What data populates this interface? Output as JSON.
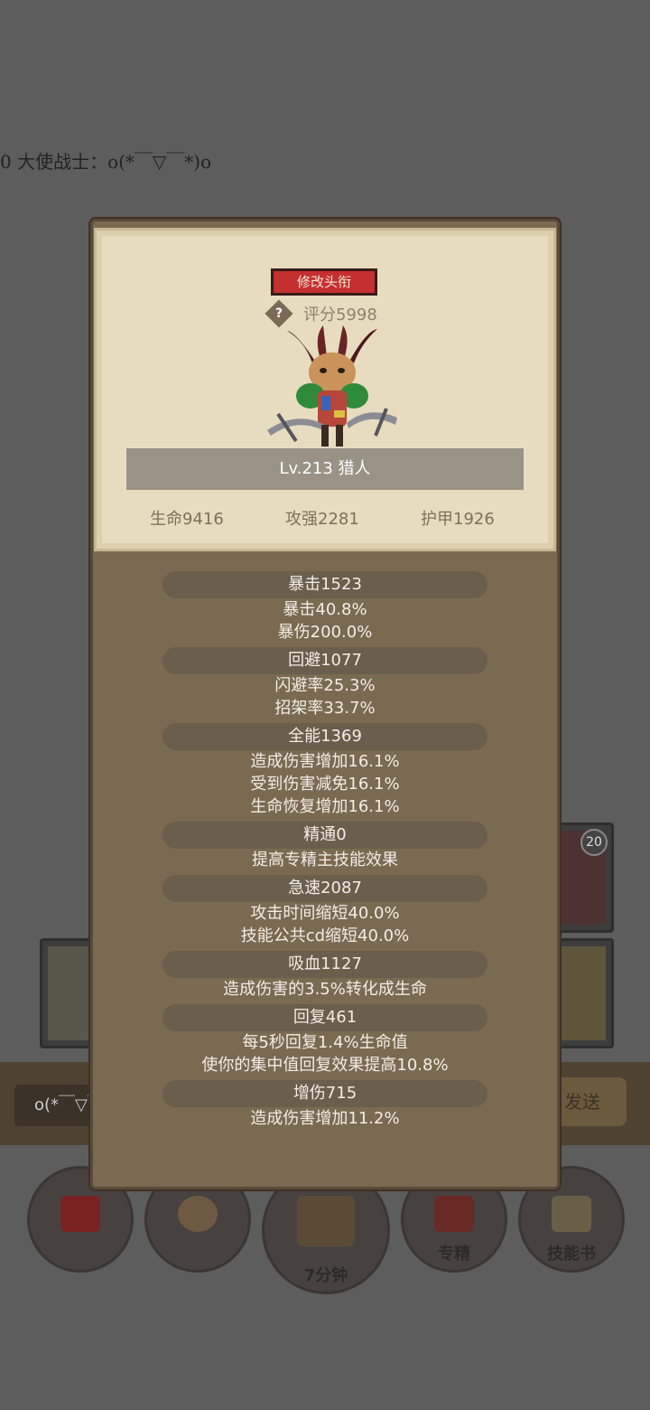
{
  "background": {
    "chat_line": "0 大使战士：o(*￣▽￣*)o",
    "chat_input": "o(*￣▽￣",
    "send_label": "发送",
    "slot_badge": "20",
    "bottom_buttons": [
      {
        "label": ""
      },
      {
        "label": ""
      },
      {
        "label": "7分钟"
      },
      {
        "label": "专精"
      },
      {
        "label": "技能书"
      }
    ]
  },
  "dialog": {
    "edit_title_button": "修改头衔",
    "help_icon": "?",
    "score": "评分5998",
    "level_class": "Lv.213 猎人",
    "top_stats": {
      "hp": "生命9416",
      "attack": "攻强2281",
      "armor": "护甲1926"
    },
    "attributes": [
      {
        "header": "暴击1523",
        "lines": [
          "暴击40.8%",
          "暴伤200.0%"
        ]
      },
      {
        "header": "回避1077",
        "lines": [
          "闪避率25.3%",
          "招架率33.7%"
        ]
      },
      {
        "header": "全能1369",
        "lines": [
          "造成伤害增加16.1%",
          "受到伤害减免16.1%",
          "生命恢复增加16.1%"
        ]
      },
      {
        "header": "精通0",
        "lines": [
          "提高专精主技能效果"
        ]
      },
      {
        "header": "急速2087",
        "lines": [
          "攻击时间缩短40.0%",
          "技能公共cd缩短40.0%"
        ]
      },
      {
        "header": "吸血1127",
        "lines": [
          "造成伤害的3.5%转化成生命"
        ]
      },
      {
        "header": "回复461",
        "lines": [
          "每5秒回复1.4%生命值",
          "使你的集中值回复效果提高10.8%"
        ]
      },
      {
        "header": "增伤715",
        "lines": [
          "造成伤害增加11.2%"
        ]
      }
    ]
  }
}
